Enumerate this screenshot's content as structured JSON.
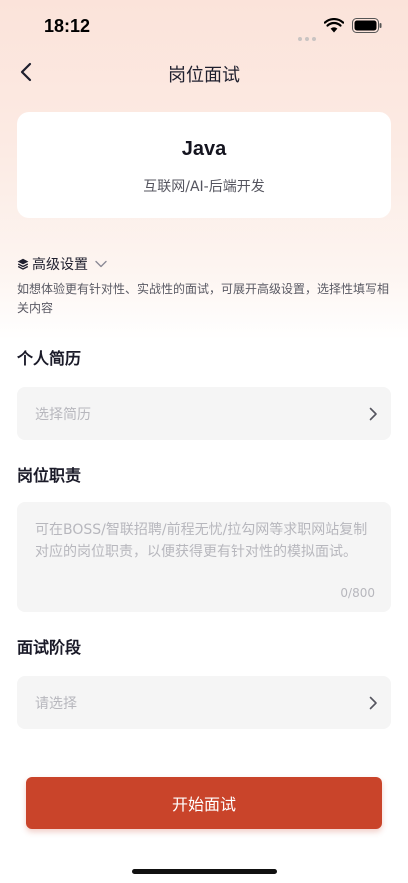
{
  "status_bar": {
    "time": "18:12",
    "icons": [
      "wifi-icon",
      "battery-icon"
    ]
  },
  "header": {
    "title": "岗位面试",
    "back_icon": "chevron-left-icon"
  },
  "job_card": {
    "title": "Java",
    "subtitle": "互联网/AI-后端开发"
  },
  "advanced": {
    "label": "高级设置",
    "icon": "layers-icon",
    "toggle_icon": "chevron-down-icon",
    "description": "如想体验更有针对性、实战性的面试，可展开高级设置，选择性填写相关内容"
  },
  "resume": {
    "label": "个人简历",
    "placeholder": "选择简历"
  },
  "duties": {
    "label": "岗位职责",
    "placeholder": "可在BOSS/智联招聘/前程无忧/拉勾网等求职网站复制对应的岗位职责，以便获得更有针对性的模拟面试。",
    "count": "0/800"
  },
  "stage": {
    "label": "面试阶段",
    "placeholder": "请选择"
  },
  "actions": {
    "start_label": "开始面试"
  },
  "colors": {
    "accent": "#c9442a",
    "field_bg": "#f5f5f5",
    "placeholder": "#b7b7bd",
    "gradient_top": "#fbe3da"
  }
}
